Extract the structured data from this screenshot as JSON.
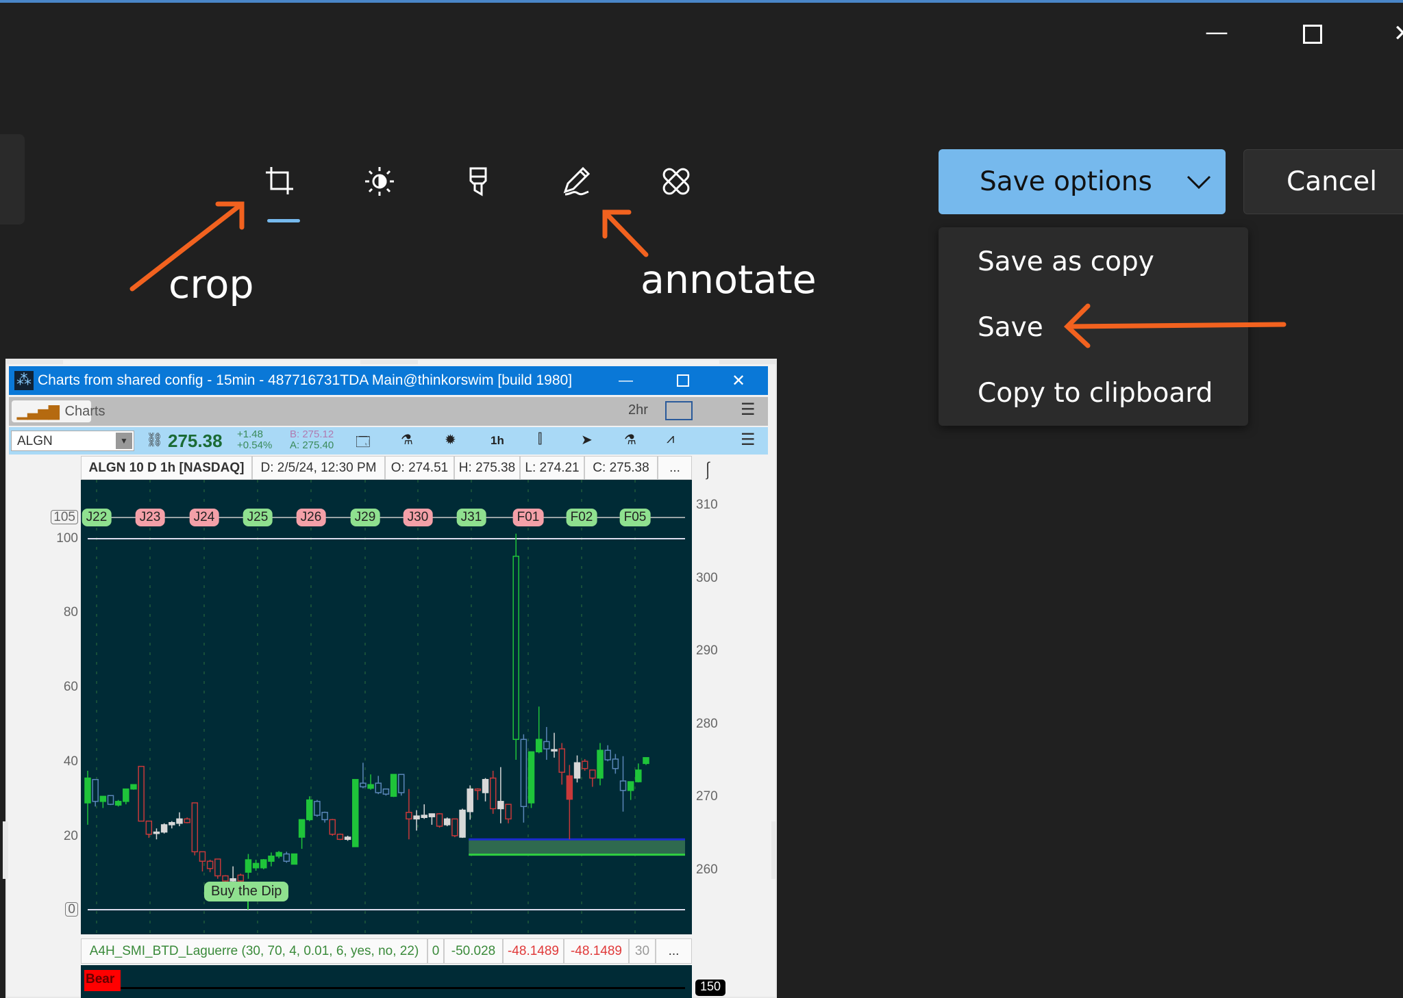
{
  "window_controls": {
    "minimize": "—",
    "maximize": "☐",
    "close": "✕"
  },
  "toolbar": {
    "tools": [
      {
        "name": "crop",
        "icon": "crop-icon",
        "active": true
      },
      {
        "name": "adjust",
        "icon": "brightness-icon"
      },
      {
        "name": "filter",
        "icon": "highlighter-icon"
      },
      {
        "name": "markup",
        "icon": "pen-icon"
      },
      {
        "name": "retouch",
        "icon": "bandage-icon"
      }
    ]
  },
  "save_options": {
    "label": "Save options",
    "chevron": "chevron-down-icon",
    "accent": "#76b9ed"
  },
  "cancel": {
    "label": "Cancel"
  },
  "menu": {
    "items": [
      "Save as copy",
      "Save",
      "Copy to clipboard"
    ]
  },
  "annotations": {
    "crop": "crop",
    "annotate": "annotate",
    "arrow_color": "#f2621f"
  },
  "chart_window": {
    "title": "Charts from shared config - 15min - 487716731TDA Main@thinkorswim [build 1980]",
    "tab": "Charts",
    "timeframe": "2hr",
    "symbol": "ALGN",
    "last": "275.38",
    "change": "+1.48",
    "change_pct": "+0.54%",
    "bid": "B: 275.12",
    "ask": "A: 275.40",
    "agg": "1h",
    "header": [
      "ALGN 10 D 1h [NASDAQ]",
      "D: 2/5/24, 12:30 PM",
      "O: 274.51",
      "H: 275.38",
      "L: 274.21",
      "C: 275.38",
      "..."
    ],
    "indicator": [
      "A4H_SMI_BTD_Laguerre (30, 70, 4, 0.01, 6, yes, no, 22)",
      "0",
      "-50.028",
      "-48.1489",
      "-48.1489",
      "30",
      "..."
    ],
    "bear_label": "Bear",
    "lower_axis_box": "150",
    "buy_label": "Buy the Dip"
  },
  "chart_data": {
    "type": "candlestick",
    "right_axis": {
      "ticks": [
        310,
        300,
        290,
        280,
        270,
        260
      ],
      "range": [
        255.5,
        314
      ]
    },
    "left_axis": {
      "ticks": [
        "105",
        "100",
        "80",
        "60",
        "40",
        "20",
        "0"
      ],
      "boxed": [
        "105",
        "0"
      ]
    },
    "date_bubbles": [
      {
        "label": "J22",
        "color": "#8fe08f"
      },
      {
        "label": "J23",
        "color": "#f4a0a8"
      },
      {
        "label": "J24",
        "color": "#f4a0a8"
      },
      {
        "label": "J25",
        "color": "#8fe08f"
      },
      {
        "label": "J26",
        "color": "#f4a0a8"
      },
      {
        "label": "J29",
        "color": "#8fe08f"
      },
      {
        "label": "J30",
        "color": "#f4a0a8"
      },
      {
        "label": "J31",
        "color": "#8fe08f"
      },
      {
        "label": "F01",
        "color": "#f4a0a8"
      },
      {
        "label": "F02",
        "color": "#8fe08f"
      },
      {
        "label": "F05",
        "color": "#8fe08f"
      }
    ],
    "zone": {
      "top": 264.2,
      "bottom": 262.1,
      "start_index": 50
    },
    "colors": {
      "g": "#1fc43a",
      "r": "#c8393a",
      "w": "#d8d8d8",
      "b": "#5a86b8",
      "gh": "#1fc43a",
      "rf": "#c8393a"
    },
    "candles": [
      [
        269.2,
        273.6,
        266.2,
        272.6,
        "g"
      ],
      [
        269.4,
        272.4,
        268.7,
        272.4,
        "b"
      ],
      [
        269.4,
        270.1,
        268.5,
        270.1,
        "g"
      ],
      [
        269.0,
        270.2,
        268.9,
        270.2,
        "b"
      ],
      [
        268.9,
        269.6,
        268.7,
        269.4,
        "g"
      ],
      [
        269.4,
        271.1,
        269.0,
        271.1,
        "g"
      ],
      [
        271.1,
        271.7,
        271.0,
        271.7,
        "g"
      ],
      [
        274.2,
        274.2,
        266.7,
        266.7,
        "r"
      ],
      [
        266.7,
        266.7,
        264.4,
        264.9,
        "r"
      ],
      [
        265.2,
        265.7,
        264.2,
        265.0,
        "w"
      ],
      [
        265.2,
        266.4,
        265.0,
        266.2,
        "w"
      ],
      [
        266.2,
        266.7,
        265.7,
        266.5,
        "w"
      ],
      [
        266.4,
        267.9,
        266.0,
        267.0,
        "w"
      ],
      [
        267.0,
        267.2,
        266.4,
        266.5,
        "r"
      ],
      [
        269.2,
        269.2,
        262.0,
        262.5,
        "r"
      ],
      [
        262.5,
        262.5,
        259.8,
        261.2,
        "r"
      ],
      [
        261.2,
        261.4,
        259.7,
        260.2,
        "r"
      ],
      [
        261.5,
        261.5,
        258.8,
        259.2,
        "r"
      ],
      [
        259.2,
        259.3,
        258.4,
        258.5,
        "r"
      ],
      [
        258.8,
        260.5,
        258.4,
        258.5,
        "w"
      ],
      [
        259.3,
        259.5,
        258.4,
        258.5,
        "r"
      ],
      [
        259.7,
        262.2,
        258.8,
        261.4,
        "g"
      ],
      [
        260.3,
        261.4,
        259.9,
        260.9,
        "g"
      ],
      [
        260.3,
        261.5,
        260.1,
        261.4,
        "g"
      ],
      [
        261.2,
        262.4,
        260.5,
        261.9,
        "g"
      ],
      [
        261.9,
        262.6,
        261.6,
        262.4,
        "g"
      ],
      [
        261.2,
        262.5,
        261.0,
        262.2,
        "b"
      ],
      [
        260.8,
        262.2,
        260.8,
        262.2,
        "g"
      ],
      [
        264.5,
        266.9,
        262.9,
        266.9,
        "g"
      ],
      [
        266.9,
        270.1,
        266.7,
        269.6,
        "g"
      ],
      [
        267.5,
        269.6,
        267.3,
        269.4,
        "b"
      ],
      [
        266.9,
        268.0,
        266.5,
        267.9,
        "b"
      ],
      [
        266.9,
        267.0,
        264.7,
        264.9,
        "r"
      ],
      [
        264.9,
        265.0,
        264.1,
        264.2,
        "r"
      ],
      [
        264.2,
        264.7,
        264.0,
        264.5,
        "w"
      ],
      [
        263.2,
        272.4,
        263.2,
        272.4,
        "g"
      ],
      [
        271.4,
        274.7,
        271.2,
        271.9,
        "b"
      ],
      [
        271.2,
        273.1,
        271.0,
        271.7,
        "g"
      ],
      [
        270.6,
        272.9,
        270.4,
        271.9,
        "b"
      ],
      [
        270.4,
        271.1,
        270.2,
        271.1,
        "b"
      ],
      [
        270.1,
        273.1,
        270.0,
        273.1,
        "g"
      ],
      [
        270.6,
        273.1,
        270.2,
        273.1,
        "b"
      ],
      [
        267.9,
        271.1,
        264.2,
        267.0,
        "r"
      ],
      [
        267.0,
        268.2,
        265.4,
        267.4,
        "w"
      ],
      [
        267.2,
        269.0,
        267.0,
        267.5,
        "w"
      ],
      [
        267.3,
        267.7,
        266.2,
        267.7,
        "w"
      ],
      [
        267.7,
        267.8,
        265.8,
        266.0,
        "r"
      ],
      [
        266.2,
        267.2,
        266.0,
        267.0,
        "w"
      ],
      [
        267.0,
        267.0,
        264.5,
        264.7,
        "r"
      ],
      [
        264.5,
        268.4,
        264.4,
        268.2,
        "w"
      ],
      [
        268.0,
        271.6,
        266.9,
        271.1,
        "w"
      ],
      [
        271.1,
        271.2,
        269.6,
        270.9,
        "r"
      ],
      [
        270.6,
        272.6,
        269.4,
        272.4,
        "w"
      ],
      [
        272.6,
        273.6,
        267.7,
        268.4,
        "r"
      ],
      [
        268.4,
        274.1,
        266.4,
        269.4,
        "w"
      ],
      [
        269.0,
        269.0,
        266.4,
        267.0,
        "r"
      ],
      [
        277.9,
        306.1,
        275.1,
        303.0,
        "gh"
      ],
      [
        268.7,
        278.6,
        266.5,
        277.9,
        "b"
      ],
      [
        269.2,
        276.2,
        268.5,
        276.2,
        "g"
      ],
      [
        276.2,
        282.4,
        276.0,
        277.9,
        "g"
      ],
      [
        276.6,
        279.6,
        275.1,
        277.6,
        "b"
      ],
      [
        276.4,
        278.8,
        275.4,
        276.5,
        "w"
      ],
      [
        276.6,
        277.4,
        271.7,
        273.4,
        "r"
      ],
      [
        272.9,
        274.4,
        264.2,
        269.7,
        "rf"
      ],
      [
        272.6,
        275.7,
        272.0,
        274.7,
        "w"
      ],
      [
        274.9,
        275.2,
        273.6,
        273.9,
        "r"
      ],
      [
        273.7,
        273.7,
        271.4,
        272.6,
        "r"
      ],
      [
        272.6,
        277.4,
        271.6,
        276.4,
        "g"
      ],
      [
        275.1,
        277.1,
        274.9,
        276.4,
        "b"
      ],
      [
        273.9,
        275.9,
        273.2,
        275.2,
        "b"
      ],
      [
        270.9,
        275.6,
        268.0,
        272.2,
        "b"
      ],
      [
        270.9,
        272.1,
        269.6,
        272.1,
        "g"
      ],
      [
        272.1,
        274.6,
        272.0,
        273.7,
        "g"
      ],
      [
        274.6,
        275.4,
        274.4,
        275.4,
        "g"
      ]
    ]
  }
}
